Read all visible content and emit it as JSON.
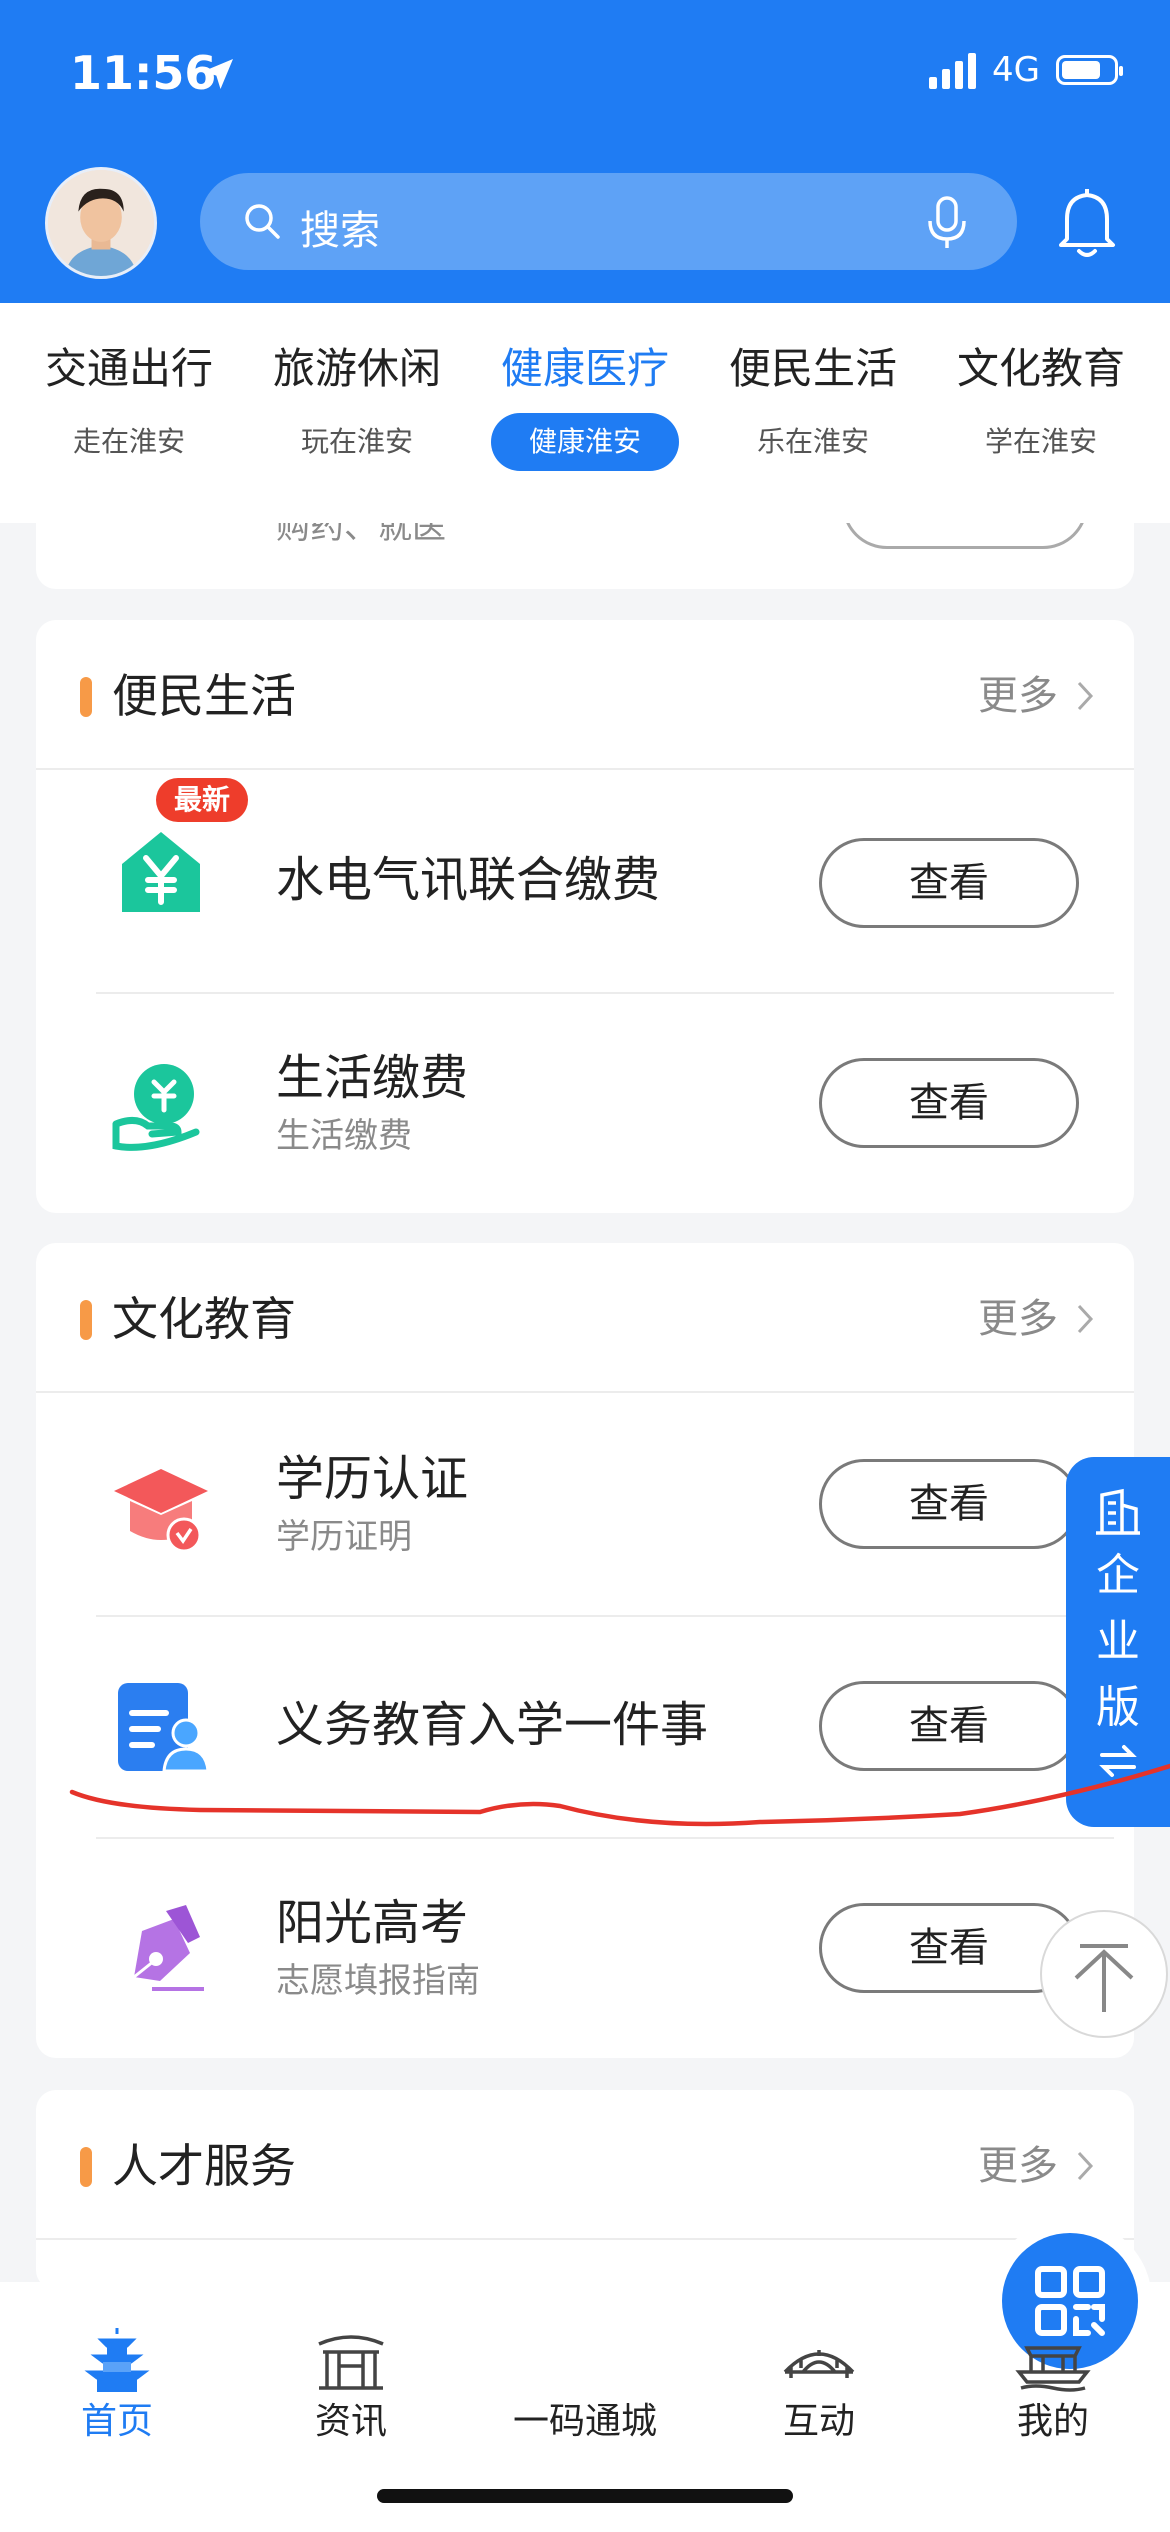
{
  "status": {
    "time": "11:56",
    "network": "4G"
  },
  "search": {
    "placeholder": "搜索"
  },
  "categories": [
    {
      "title": "交通出行",
      "sub": "走在淮安"
    },
    {
      "title": "旅游休闲",
      "sub": "玩在淮安"
    },
    {
      "title": "健康医疗",
      "sub": "健康淮安",
      "active": true
    },
    {
      "title": "便民生活",
      "sub": "乐在淮安"
    },
    {
      "title": "文化教育",
      "sub": "学在淮安"
    }
  ],
  "previous_card": {
    "partial_text": "购药、就医"
  },
  "sections": {
    "life": {
      "title": "便民生活",
      "more": "更多",
      "items": [
        {
          "name": "水电气讯联合缴费",
          "badge": "最新",
          "button": "查看"
        },
        {
          "name": "生活缴费",
          "sub": "生活缴费",
          "button": "查看"
        }
      ]
    },
    "education": {
      "title": "文化教育",
      "more": "更多",
      "items": [
        {
          "name": "学历认证",
          "sub": "学历证明",
          "button": "查看"
        },
        {
          "name": "义务教育入学一件事",
          "button": "查看"
        },
        {
          "name": "阳光高考",
          "sub": "志愿填报指南",
          "button": "查看"
        }
      ]
    },
    "talent": {
      "title": "人才服务",
      "more": "更多"
    }
  },
  "enterprise": {
    "chars": [
      "企",
      "业",
      "版"
    ]
  },
  "tabbar": [
    {
      "label": "首页",
      "icon": "pagoda-icon",
      "active": true
    },
    {
      "label": "资讯",
      "icon": "gate-icon"
    },
    {
      "label": "一码通城",
      "icon": "qr-code-icon"
    },
    {
      "label": "互动",
      "icon": "bridge-icon"
    },
    {
      "label": "我的",
      "icon": "boat-icon"
    }
  ],
  "colors": {
    "primary": "#1f7cf3",
    "accent_bar": "#f79a47",
    "badge_red": "#ee3d2b",
    "annotation_red": "#e5332a"
  }
}
